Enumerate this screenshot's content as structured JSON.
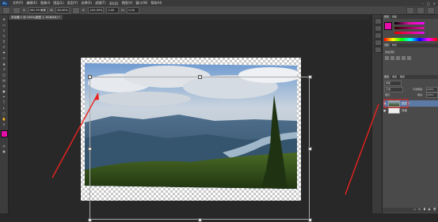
{
  "app": {
    "logo": "Ps"
  },
  "menu": [
    "文件(F)",
    "编辑(E)",
    "图像(I)",
    "图层(L)",
    "类型(Y)",
    "选择(S)",
    "滤镜(T)",
    "3D(D)",
    "视图(V)",
    "窗口(W)",
    "帮助(H)"
  ],
  "options": {
    "fields": [
      "461.99 像素",
      "80.00%",
      "-100.00%",
      "0.00",
      "0.00"
    ]
  },
  "document": {
    "tab": "未标题-1 @ 100%(图层 1, RGB/8#) *"
  },
  "layers": {
    "items": [
      {
        "name": "图层 1",
        "selected": true
      },
      {
        "name": "背景",
        "selected": false
      }
    ],
    "opacity": "100%",
    "fill": "100%"
  },
  "colors": {
    "foreground": "#e60ea8",
    "annotation": "#e8231e",
    "sky": "#6f9bd1",
    "mountain": "#3a5a75",
    "forest": "#2e4a1c"
  }
}
